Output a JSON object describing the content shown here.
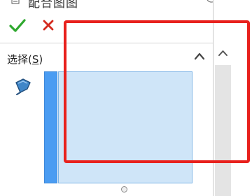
{
  "header": {
    "title": "配合图图",
    "title_icon": "property-sheet-icon",
    "help_icon": "help-circle-icon"
  },
  "actions": {
    "ok_icon": "checkmark-icon",
    "cancel_icon": "close-icon",
    "ok_color": "#2ea82e",
    "cancel_color": "#d42a1e"
  },
  "selection_section": {
    "label_prefix": "选择(",
    "label_key": "S",
    "label_suffix": ")",
    "collapse_icon": "chevron-up-icon",
    "selection_icon": "selection-filter-icon",
    "list_accent_color": "#4a9cf2",
    "list_background_color": "#cfe5f8"
  },
  "scrollbar": {
    "up_icon": "chevron-up-icon"
  },
  "annotation": {
    "highlight_color": "#e8211d"
  }
}
